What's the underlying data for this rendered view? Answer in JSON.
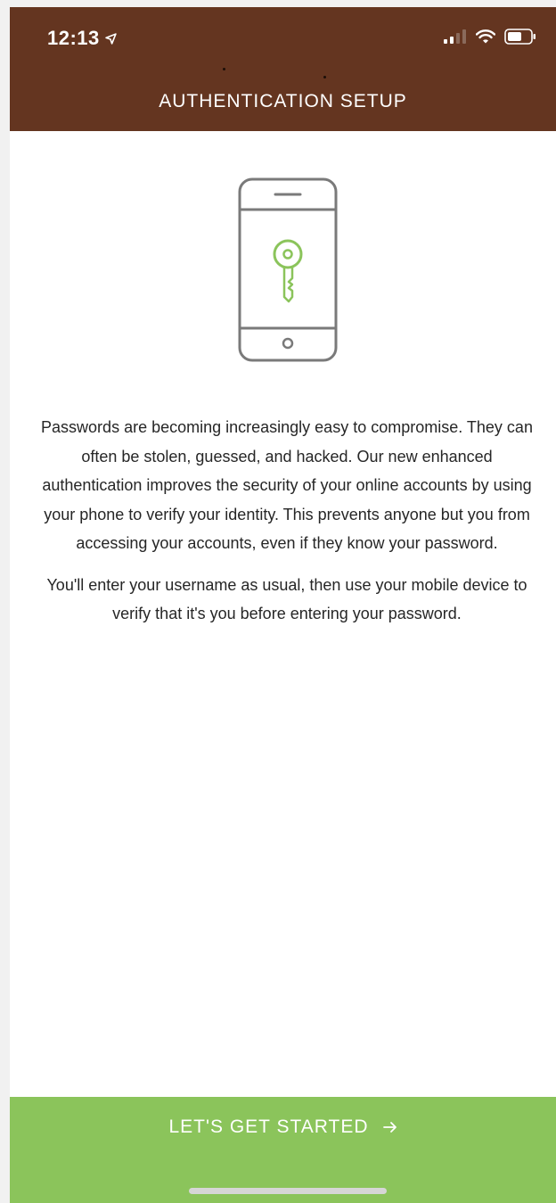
{
  "status_bar": {
    "time": "12:13",
    "location_icon": "location-arrow-icon",
    "signal_icon": "cellular-signal-icon",
    "wifi_icon": "wifi-icon",
    "battery_icon": "battery-icon"
  },
  "header": {
    "title": "AUTHENTICATION SETUP"
  },
  "illustration": {
    "icon": "phone-with-key-icon"
  },
  "content": {
    "paragraph_1": "Passwords are becoming increasingly easy to compromise. They can often be stolen, guessed, and hacked. Our new enhanced authentication improves the security of your online accounts by using your phone to verify your identity. This prevents anyone but you from accessing your accounts, even if they know your password.",
    "paragraph_2": "You'll enter your username as usual, then use your mobile device to verify that it's you before entering your password."
  },
  "cta": {
    "label": "LET'S GET STARTED",
    "icon": "arrow-right-icon"
  },
  "colors": {
    "header_bg": "#643520",
    "accent_green": "#8bc45b",
    "phone_outline": "#7a7a7a",
    "key_green": "#8bc45b"
  }
}
